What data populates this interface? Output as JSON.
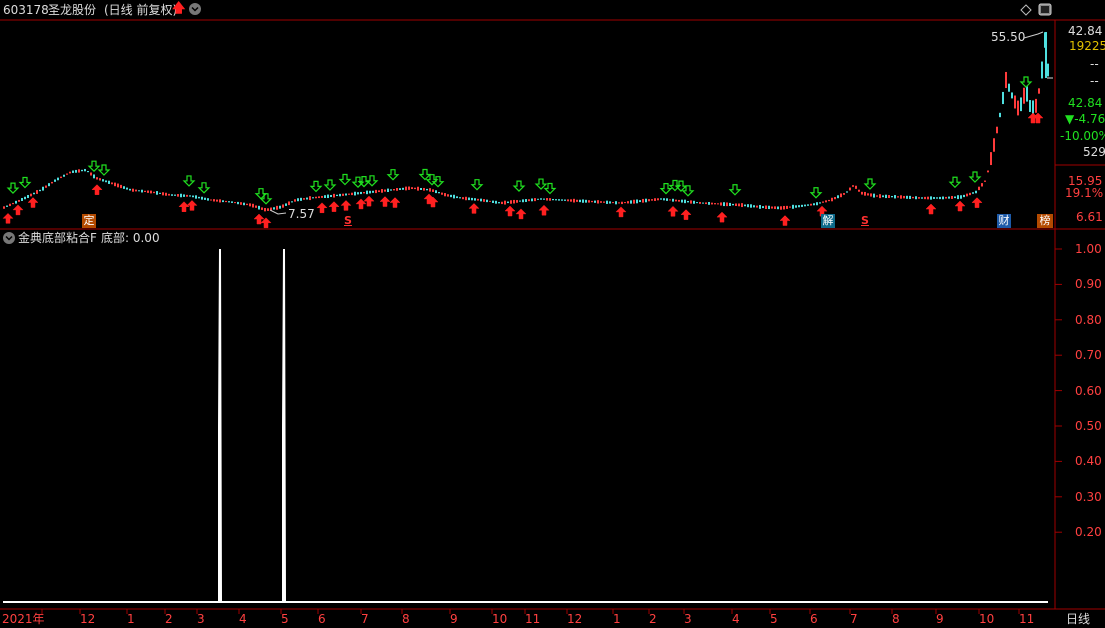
{
  "header": {
    "stock_code": "603178",
    "stock_name": "圣龙股份",
    "mode": "(日线 前复权)",
    "up_icon": "red-up-arrow-icon",
    "dropdown_icon": "chevron-down-icon",
    "diamond_icon": "diamond-icon",
    "window_icon": "window-icon"
  },
  "price_axis": {
    "top_price": "42.84",
    "volume": "19225",
    "dash1": "--",
    "dash2": "--",
    "last_price": "42.84",
    "change": "▼-4.76",
    "change_pct": "-10.00%",
    "count": "529",
    "level1": "15.95",
    "level1_pct": "19.1%",
    "bottom_price": "6.61"
  },
  "annotations": {
    "high_label": "55.50",
    "low_label": "7.57",
    "event_ding": "定",
    "event_s1": "S",
    "event_jie": "解",
    "event_s2": "S",
    "event_cai": "财",
    "event_bang": "榜"
  },
  "indicator": {
    "title": "金典底部粘合F",
    "series_label": "底部: 0.00",
    "collapse_icon": "chevron-down-icon",
    "ticks": [
      "1.00",
      "0.90",
      "0.80",
      "0.70",
      "0.60",
      "0.50",
      "0.40",
      "0.30",
      "0.20"
    ]
  },
  "x_axis": {
    "labels": [
      "2021年",
      "12",
      "1",
      "2",
      "3",
      "4",
      "5",
      "6",
      "7",
      "8",
      "9",
      "10",
      "11",
      "12",
      "1",
      "2",
      "3",
      "4",
      "5",
      "6",
      "7",
      "8",
      "9",
      "10",
      "11"
    ],
    "period_button": "日线"
  },
  "colors": {
    "up": "#ff3b3b",
    "down": "#4fe0e0",
    "buy_arrow": "#ff2020",
    "sell_arrow": "#20e020",
    "grid": "#a00000",
    "signal": "#ffffff"
  },
  "chart_data": {
    "type": "line",
    "title": "金典底部粘合F",
    "series": [
      {
        "name": "底部",
        "description": "spikes to 1.00 at two dates, otherwise 0"
      }
    ],
    "ylim": [
      0,
      1
    ],
    "spike_months": [
      "3",
      "5"
    ]
  }
}
